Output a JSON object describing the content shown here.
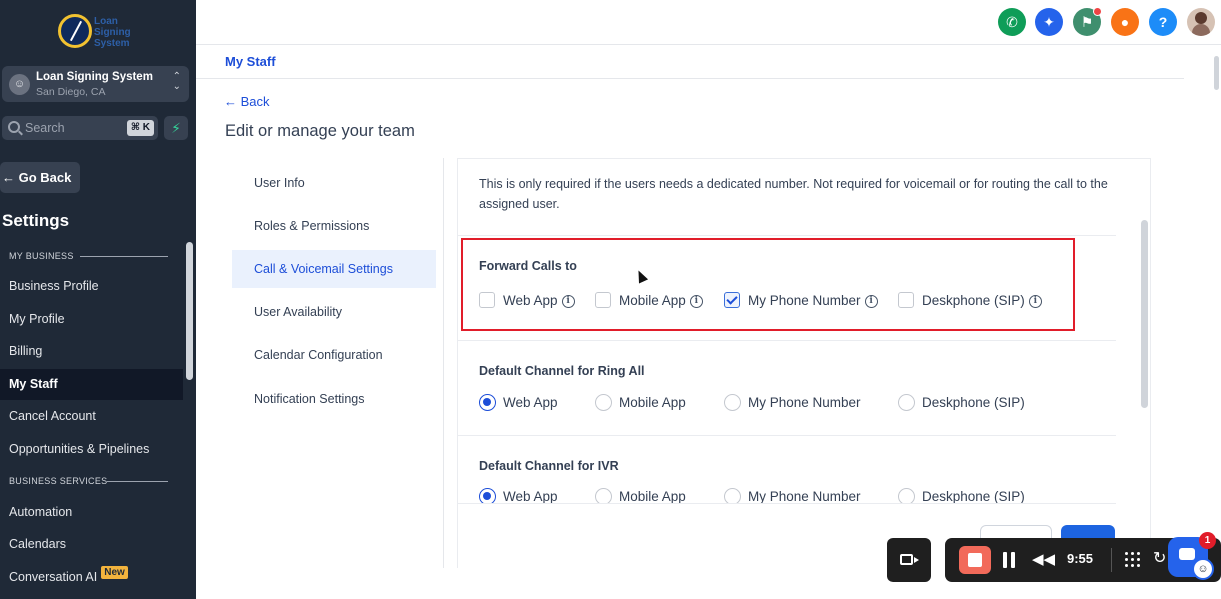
{
  "sidebar": {
    "logo_text": [
      "Loan",
      "Signing",
      "System"
    ],
    "account": {
      "name": "Loan Signing System",
      "location": "San Diego, CA"
    },
    "search": {
      "label": "Search",
      "shortcut": "⌘ K"
    },
    "go_back": "← Go Back",
    "settings_title": "Settings",
    "sections": [
      {
        "label": "MY BUSINESS"
      },
      {
        "label": "BUSINESS SERVICES"
      }
    ],
    "items": [
      {
        "label": "Business Profile"
      },
      {
        "label": "My Profile"
      },
      {
        "label": "Billing"
      },
      {
        "label": "My Staff",
        "active": true
      },
      {
        "label": "Cancel Account"
      },
      {
        "label": "Opportunities & Pipelines"
      },
      {
        "label": "Automation"
      },
      {
        "label": "Calendars"
      },
      {
        "label": "Conversation AI",
        "badge": "New"
      }
    ]
  },
  "topbar": {
    "icons": [
      {
        "name": "phone-icon",
        "color": "#0f9d58"
      },
      {
        "name": "magic-wand-icon",
        "color": "#2563eb"
      },
      {
        "name": "megaphone-icon",
        "color": "#3f8f6e"
      },
      {
        "name": "bell-icon",
        "color": "#f97316"
      },
      {
        "name": "help-icon",
        "color": "#1d8cf8"
      }
    ]
  },
  "main": {
    "tab": "My Staff",
    "back": "← Back",
    "title": "Edit or manage your team",
    "subnav": [
      {
        "label": "User Info"
      },
      {
        "label": "Roles & Permissions"
      },
      {
        "label": "Call & Voicemail Settings",
        "active": true
      },
      {
        "label": "User Availability"
      },
      {
        "label": "Calendar Configuration"
      },
      {
        "label": "Notification Settings"
      }
    ],
    "note": "This is only required if the users needs a dedicated number. Not required for voicemail or for routing the call to the assigned user.",
    "forward_calls": {
      "label": "Forward Calls to",
      "options": [
        {
          "label": "Web App",
          "checked": false
        },
        {
          "label": "Mobile App",
          "checked": false
        },
        {
          "label": "My Phone Number",
          "checked": true
        },
        {
          "label": "Deskphone (SIP)",
          "checked": false
        }
      ]
    },
    "ring_all": {
      "label": "Default Channel for Ring All",
      "options": [
        {
          "label": "Web App",
          "selected": true
        },
        {
          "label": "Mobile App",
          "selected": false
        },
        {
          "label": "My Phone Number",
          "selected": false
        },
        {
          "label": "Deskphone (SIP)",
          "selected": false
        }
      ]
    },
    "ivr": {
      "label": "Default Channel for IVR",
      "options": [
        {
          "label": "Web App",
          "selected": true
        },
        {
          "label": "Mobile App",
          "selected": false
        },
        {
          "label": "My Phone Number",
          "selected": false
        },
        {
          "label": "Deskphone (SIP)",
          "selected": false
        }
      ]
    }
  },
  "recorder": {
    "time": "9:55"
  },
  "chat": {
    "badge_count": "1"
  },
  "colors": {
    "accent": "#1d4ed8",
    "sidebar_bg": "#1f2937",
    "highlight": "#e11d2a"
  }
}
